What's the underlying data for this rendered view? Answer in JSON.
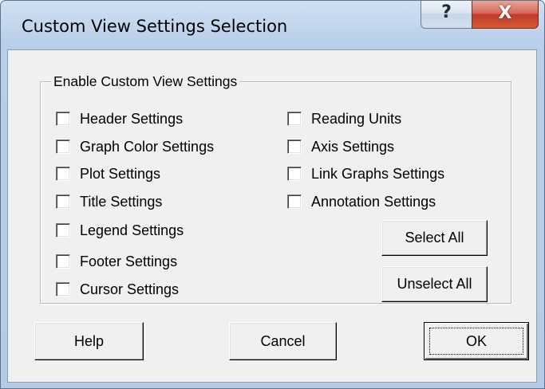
{
  "window": {
    "title": "Custom View Settings Selection",
    "help_glyph": "?",
    "close_glyph": "X"
  },
  "group": {
    "legend": "Enable Custom View Settings",
    "left_column": [
      {
        "label": "Header Settings",
        "checked": false
      },
      {
        "label": "Graph Color Settings",
        "checked": false
      },
      {
        "label": "Plot Settings",
        "checked": false
      },
      {
        "label": "Title Settings",
        "checked": false
      },
      {
        "label": "Legend Settings",
        "checked": false
      },
      {
        "label": "Footer Settings",
        "checked": false
      },
      {
        "label": "Cursor Settings",
        "checked": false
      }
    ],
    "right_column": [
      {
        "label": "Reading Units",
        "checked": false
      },
      {
        "label": "Axis Settings",
        "checked": false
      },
      {
        "label": "Link Graphs Settings",
        "checked": false
      },
      {
        "label": "Annotation Settings",
        "checked": false
      }
    ],
    "select_all_label": "Select All",
    "unselect_all_label": "Unselect All"
  },
  "buttons": {
    "help_label": "Help",
    "cancel_label": "Cancel",
    "ok_label": "OK"
  }
}
